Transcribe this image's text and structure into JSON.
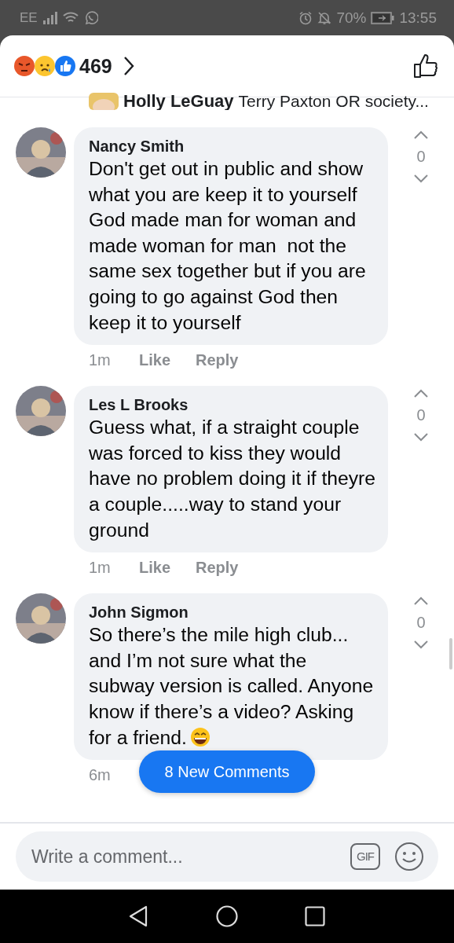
{
  "status_bar": {
    "carrier": "EE",
    "battery": "70%",
    "time": "13:55"
  },
  "header": {
    "reaction_count": "469"
  },
  "reply_preview": {
    "name": "Holly LeGuay",
    "text": "Terry Paxton OR society..."
  },
  "comments": [
    {
      "name": "Nancy Smith",
      "text": "Don't get out in public and show what you are keep it to yourself  God made man for woman and made woman for man  not the same sex together but if you are going to go against God then keep it to yourself",
      "emoji": false,
      "votes": "0",
      "time": "1m",
      "actions": [
        "Like",
        "Reply"
      ]
    },
    {
      "name": "Les L Brooks",
      "text": "Guess what, if a straight couple was forced to kiss they would have no problem doing it if theyre a couple.....way to stand your ground",
      "emoji": false,
      "votes": "0",
      "time": "1m",
      "actions": [
        "Like",
        "Reply"
      ]
    },
    {
      "name": "John Sigmon",
      "text": "So there’s the mile high club... and I’m not sure what the subway version is called. Anyone know if there’s a video? Asking for a friend.",
      "emoji": true,
      "votes": "0",
      "time": "6m"
    }
  ],
  "new_comments_button": "8 New Comments",
  "composer": {
    "placeholder": "Write a comment...",
    "gif": "GIF"
  }
}
